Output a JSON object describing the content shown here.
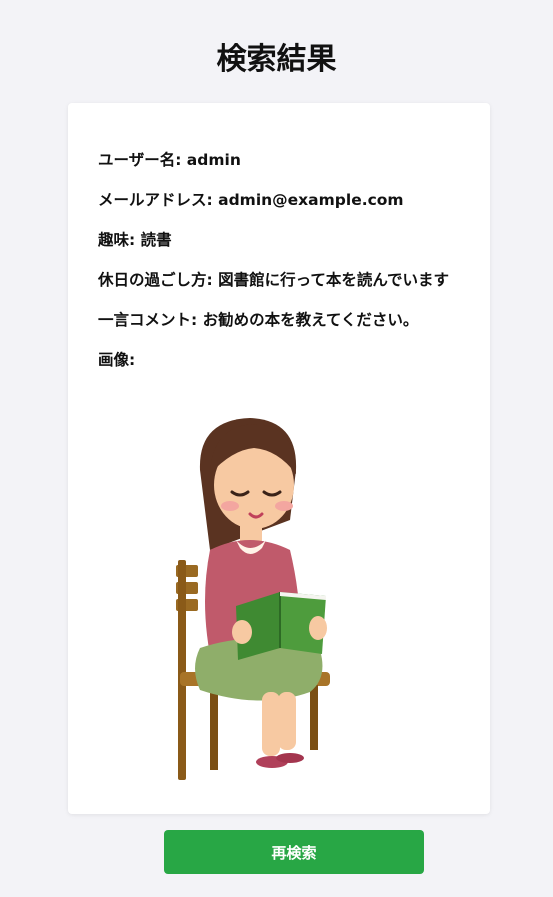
{
  "page": {
    "title": "検索結果"
  },
  "profile": {
    "username_label": "ユーザー名:",
    "username": "admin",
    "email_label": "メールアドレス:",
    "email": "admin@example.com",
    "hobby_label": "趣味:",
    "hobby": "読書",
    "holiday_label": "休日の過ごし方:",
    "holiday": "図書館に行って本を読んでいます",
    "comment_label": "一言コメント:",
    "comment": "お勧めの本を教えてください。",
    "image_label": "画像:"
  },
  "actions": {
    "research_label": "再検索"
  },
  "colors": {
    "button": "#28a745",
    "background": "#f3f3f7"
  },
  "image": {
    "icon": "woman-reading-book-illustration"
  }
}
